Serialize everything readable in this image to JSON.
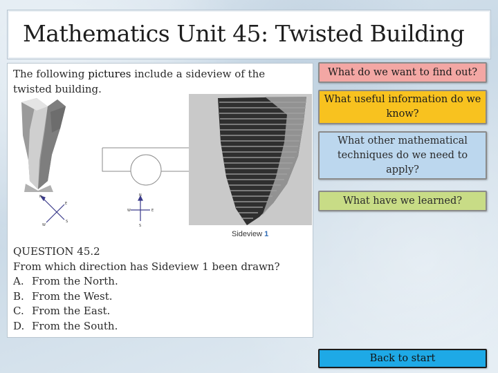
{
  "title": "Mathematics Unit 45: Twisted Building",
  "intro": {
    "before": "The following ",
    "highlight": "pictures",
    "after": " include a sideview of the twisted building."
  },
  "figure": {
    "caption_text": "Sideview ",
    "caption_num": "1",
    "compass_left": {
      "n": "N",
      "e": "E",
      "s": "S",
      "w": "W"
    },
    "compass_center": {
      "n": "N",
      "e": "E",
      "s": "S",
      "w": "W"
    }
  },
  "question": {
    "heading": "QUESTION 45.2",
    "prompt": "From which direction has Sideview 1 been drawn?",
    "options": [
      {
        "label": "A.",
        "text": "From the North."
      },
      {
        "label": "B.",
        "text": "From the West."
      },
      {
        "label": "C.",
        "text": "From the East."
      },
      {
        "label": "D.",
        "text": "From the South."
      }
    ]
  },
  "nav": {
    "find_out": "What do we want to find out?",
    "useful_info": "What useful information do we know?",
    "techniques": "What other mathematical techniques do we need to apply?",
    "learned": "What have we learned?",
    "back": "Back to start"
  },
  "colors": {
    "find_out": "#f3a7a4",
    "useful_info": "#f8c21f",
    "techniques": "#bcd7ee",
    "learned": "#c8dc86",
    "back": "#1ea9e6"
  }
}
